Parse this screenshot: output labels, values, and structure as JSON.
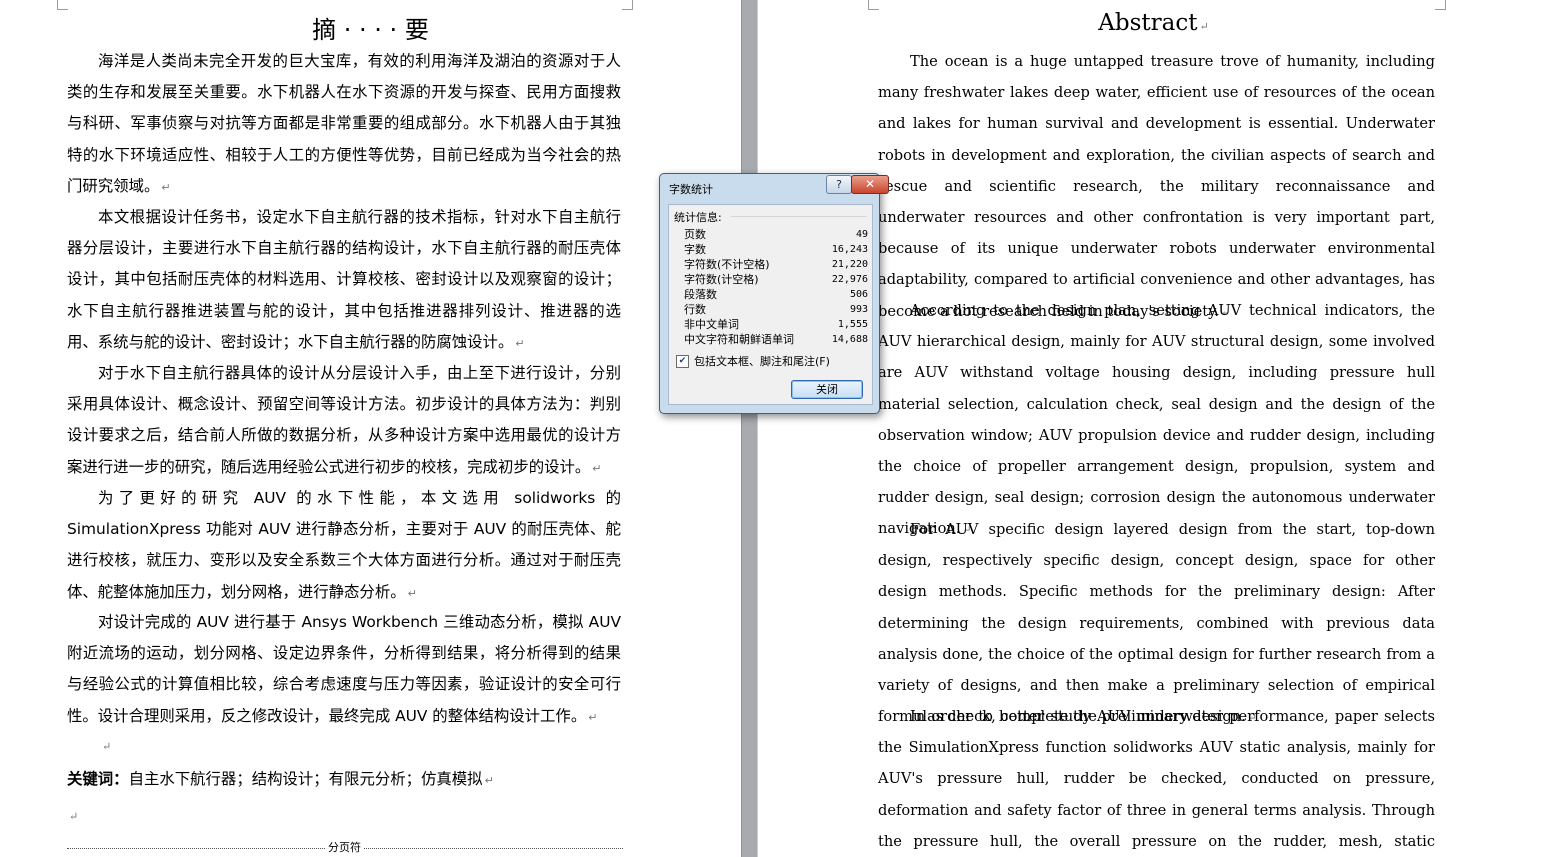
{
  "left_page": {
    "title": "摘 · · · · 要",
    "paragraphs": [
      "海洋是人类尚未完全开发的巨大宝库，有效的利用海洋及湖泊的资源对于人类的生存和发展至关重要。水下机器人在水下资源的开发与探查、民用方面搜救与科研、军事侦察与对抗等方面都是非常重要的组成部分。水下机器人由于其独特的水下环境适应性、相较于人工的方便性等优势，目前已经成为当今社会的热门研究领域。",
      "本文根据设计任务书，设定水下自主航行器的技术指标，针对水下自主航行器分层设计，主要进行水下自主航行器的结构设计，水下自主航行器的耐压壳体设计，其中包括耐压壳体的材料选用、计算校核、密封设计以及观察窗的设计；水下自主航行器推进装置与舵的设计，其中包括推进器排列设计、推进器的选用、系统与舵的设计、密封设计；水下自主航行器的防腐蚀设计。",
      "对于水下自主航行器具体的设计从分层设计入手，由上至下进行设计，分别采用具体设计、概念设计、预留空间等设计方法。初步设计的具体方法为：判别设计要求之后，结合前人所做的数据分析，从多种设计方案中选用最优的设计方案进行进一步的研究，随后选用经验公式进行初步的校核，完成初步的设计。",
      "为了更好的研究 AUV 的水下性能，本文选用 solidworks 的 SimulationXpress 功能对 AUV 进行静态分析，主要对于 AUV 的耐压壳体、舵进行校核，就压力、变形以及安全系数三个大体方面进行分析。通过对于耐压壳体、舵整体施加压力，划分网格，进行静态分析。",
      "对设计完成的 AUV 进行基于 Ansys Workbench 三维动态分析，模拟 AUV 附近流场的运动，划分网格、设定边界条件，分析得到结果，将分析得到的结果与经验公式的计算值相比较，综合考虑速度与压力等因素，验证设计的安全可行性。设计合理则采用，反之修改设计，最终完成 AUV 的整体结构设计工作。"
    ],
    "keywords_label": "关键词：",
    "keywords": "自主水下航行器；结构设计；有限元分析；仿真模拟",
    "paragraph_mark": "↵",
    "page_break_label": "分页符"
  },
  "right_page": {
    "title": "Abstract",
    "paragraphs": [
      "The ocean is a huge untapped treasure trove of humanity, including many freshwater lakes deep water, efficient use of resources of the ocean and lakes for human survival and development is essential. Underwater robots in development and exploration, the civilian aspects of search and rescue and scientific research, the military reconnaissance and underwater resources and other confrontation is very important part, because of its unique underwater robots underwater environmental adaptability, compared to artificial convenience and other advantages, has become a hot research field in today's society.",
      "According to the design plan, setting AUV technical indicators, the AUV hierarchical design, mainly for AUV structural design, some involved are AUV withstand voltage housing design, including pressure hull material selection, calculation check, seal design and the design of the observation window; AUV propulsion device and rudder design, including the choice of propeller arrangement design, propulsion, system and rudder design, seal design; corrosion design the autonomous underwater navigation.",
      "For AUV specific design layered design from the start, top-down design, respectively specific design, concept design, space for other design methods. Specific methods for the preliminary design: After determining the design requirements, combined with previous data analysis done, the choice of the optimal design for further research from a variety of designs, and then make a preliminary selection of empirical formulas check, complete the preliminary design.",
      "In order to better study AUV underwater performance, paper selects the SimulationXpress function solidworks AUV static analysis, mainly for AUV's pressure hull, rudder be checked, conducted on pressure, deformation and safety factor of three in general terms analysis. Through the pressure hull, the overall pressure on the rudder, mesh, static analysis."
    ]
  },
  "dialog": {
    "title": "字数统计",
    "help_label": "?",
    "close_x_label": "✕",
    "group_label": "统计信息:",
    "stats": [
      {
        "label": "页数",
        "value": "49"
      },
      {
        "label": "字数",
        "value": "16,243"
      },
      {
        "label": "字符数(不计空格)",
        "value": "21,220"
      },
      {
        "label": "字符数(计空格)",
        "value": "22,976"
      },
      {
        "label": "段落数",
        "value": "506"
      },
      {
        "label": "行数",
        "value": "993"
      },
      {
        "label": "非中文单词",
        "value": "1,555"
      },
      {
        "label": "中文字符和朝鲜语单词",
        "value": "14,688"
      }
    ],
    "include_label": "包括文本框、脚注和尾注(F)",
    "include_checked": true,
    "close_button_label": "关闭"
  }
}
